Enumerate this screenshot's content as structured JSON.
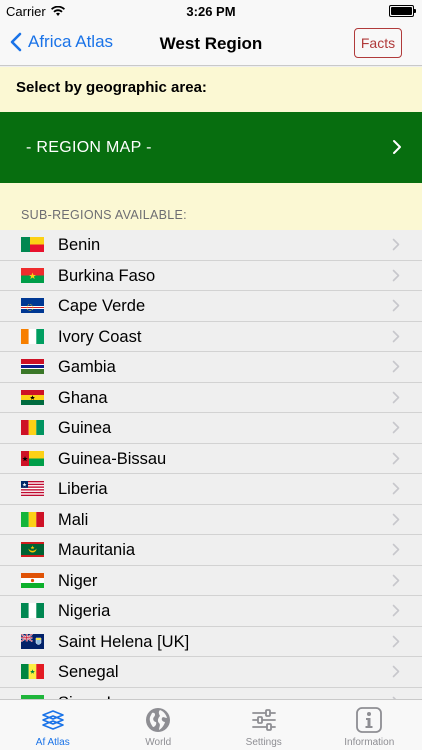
{
  "status_bar": {
    "carrier": "Carrier",
    "time": "3:26 PM"
  },
  "nav": {
    "back_label": "Africa Atlas",
    "title": "West Region",
    "facts_label": "Facts"
  },
  "select_label": "Select by geographic area:",
  "region_map_label": "- REGION MAP -",
  "subregions_label": "SUB-REGIONS AVAILABLE:",
  "countries": [
    {
      "name": "Benin",
      "flag": "benin"
    },
    {
      "name": "Burkina Faso",
      "flag": "burkina-faso"
    },
    {
      "name": "Cape Verde",
      "flag": "cape-verde"
    },
    {
      "name": "Ivory Coast",
      "flag": "ivory-coast"
    },
    {
      "name": "Gambia",
      "flag": "gambia"
    },
    {
      "name": "Ghana",
      "flag": "ghana"
    },
    {
      "name": "Guinea",
      "flag": "guinea"
    },
    {
      "name": "Guinea-Bissau",
      "flag": "guinea-bissau"
    },
    {
      "name": "Liberia",
      "flag": "liberia"
    },
    {
      "name": "Mali",
      "flag": "mali"
    },
    {
      "name": "Mauritania",
      "flag": "mauritania"
    },
    {
      "name": "Niger",
      "flag": "niger"
    },
    {
      "name": "Nigeria",
      "flag": "nigeria"
    },
    {
      "name": "Saint Helena [UK]",
      "flag": "saint-helena"
    },
    {
      "name": "Senegal",
      "flag": "senegal"
    },
    {
      "name": "Sierra Leone",
      "flag": "sierra-leone"
    }
  ],
  "tabs": [
    {
      "label": "Af Atlas",
      "icon": "atlas-layers-icon",
      "active": true
    },
    {
      "label": "World",
      "icon": "globe-icon",
      "active": false
    },
    {
      "label": "Settings",
      "icon": "sliders-icon",
      "active": false
    },
    {
      "label": "Information",
      "icon": "info-icon",
      "active": false
    }
  ],
  "colors": {
    "accent": "#1a73e8",
    "facts": "#b03a3a",
    "region_map_bg": "#076e0f",
    "header_bg": "#fbf8d3",
    "list_bg": "#efefef"
  }
}
